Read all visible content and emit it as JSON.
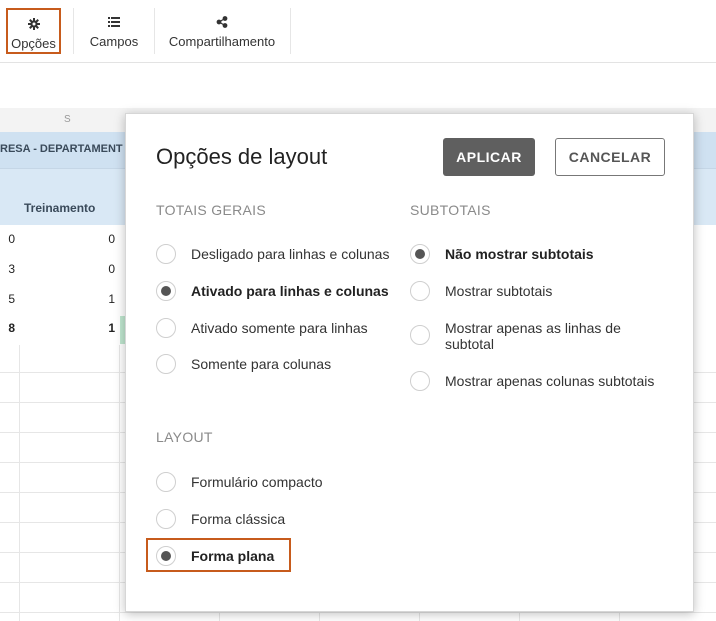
{
  "toolbar": {
    "options_label": "Opções",
    "fields_label": "Campos",
    "share_label": "Compartilhamento"
  },
  "grid": {
    "column_letter": "S",
    "dept_header": "RESA - DEPARTAMENT",
    "col_header": "Treinamento",
    "rows": [
      {
        "a": "0",
        "b": "0"
      },
      {
        "a": "3",
        "b": "0"
      },
      {
        "a": "5",
        "b": "1"
      },
      {
        "a": "8",
        "b": "1"
      }
    ]
  },
  "dialog": {
    "title": "Opções de layout",
    "apply_label": "APLICAR",
    "cancel_label": "CANCELAR",
    "grand_totals": {
      "heading": "TOTAIS GERAIS",
      "options": [
        {
          "label": "Desligado para linhas e colunas",
          "selected": false
        },
        {
          "label": "Ativado para linhas e colunas",
          "selected": true
        },
        {
          "label": "Ativado somente para linhas",
          "selected": false
        },
        {
          "label": "Somente para colunas",
          "selected": false
        }
      ]
    },
    "subtotals": {
      "heading": "SUBTOTAIS",
      "options": [
        {
          "label": "Não mostrar subtotais",
          "selected": true
        },
        {
          "label": "Mostrar subtotais",
          "selected": false
        },
        {
          "label": "Mostrar apenas as linhas de subtotal",
          "selected": false
        },
        {
          "label": "Mostrar apenas colunas subtotais",
          "selected": false
        }
      ]
    },
    "layout": {
      "heading": "LAYOUT",
      "options": [
        {
          "label": "Formulário compacto",
          "selected": false
        },
        {
          "label": "Forma clássica",
          "selected": false
        },
        {
          "label": "Forma plana",
          "selected": true
        }
      ]
    }
  },
  "colors": {
    "highlight": "#c75b1c",
    "apply_bg": "#5f5f5f",
    "header_blue": "#cfe1f1"
  }
}
